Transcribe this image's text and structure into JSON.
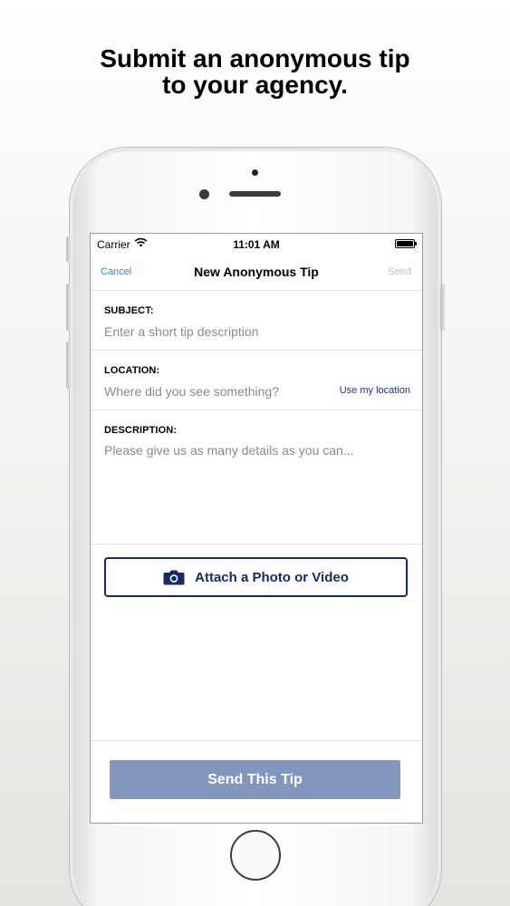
{
  "headline": {
    "line1": "Submit an anonymous tip",
    "line2": "to your agency."
  },
  "status_bar": {
    "carrier": "Carrier",
    "time": "11:01 AM",
    "wifi_icon": "wifi-icon",
    "battery_icon": "battery-icon"
  },
  "nav": {
    "cancel_label": "Cancel",
    "title": "New Anonymous Tip",
    "send_label": "Send"
  },
  "form": {
    "subject": {
      "label": "SUBJECT:",
      "value": "",
      "placeholder": "Enter a short tip description"
    },
    "location": {
      "label": "LOCATION:",
      "value": "",
      "placeholder": "Where did you see something?",
      "use_location_label": "Use my location"
    },
    "description": {
      "label": "DESCRIPTION:",
      "value": "",
      "placeholder": "Please give us as many details as you can..."
    }
  },
  "attach": {
    "label": "Attach a Photo or Video",
    "icon": "camera-icon"
  },
  "send_tip": {
    "label": "Send This Tip"
  },
  "colors": {
    "primary_navy": "#152a66",
    "link_blue": "#3b82c4",
    "send_disabled": "#a9c6e2",
    "send_button_bg": "#8197be"
  }
}
